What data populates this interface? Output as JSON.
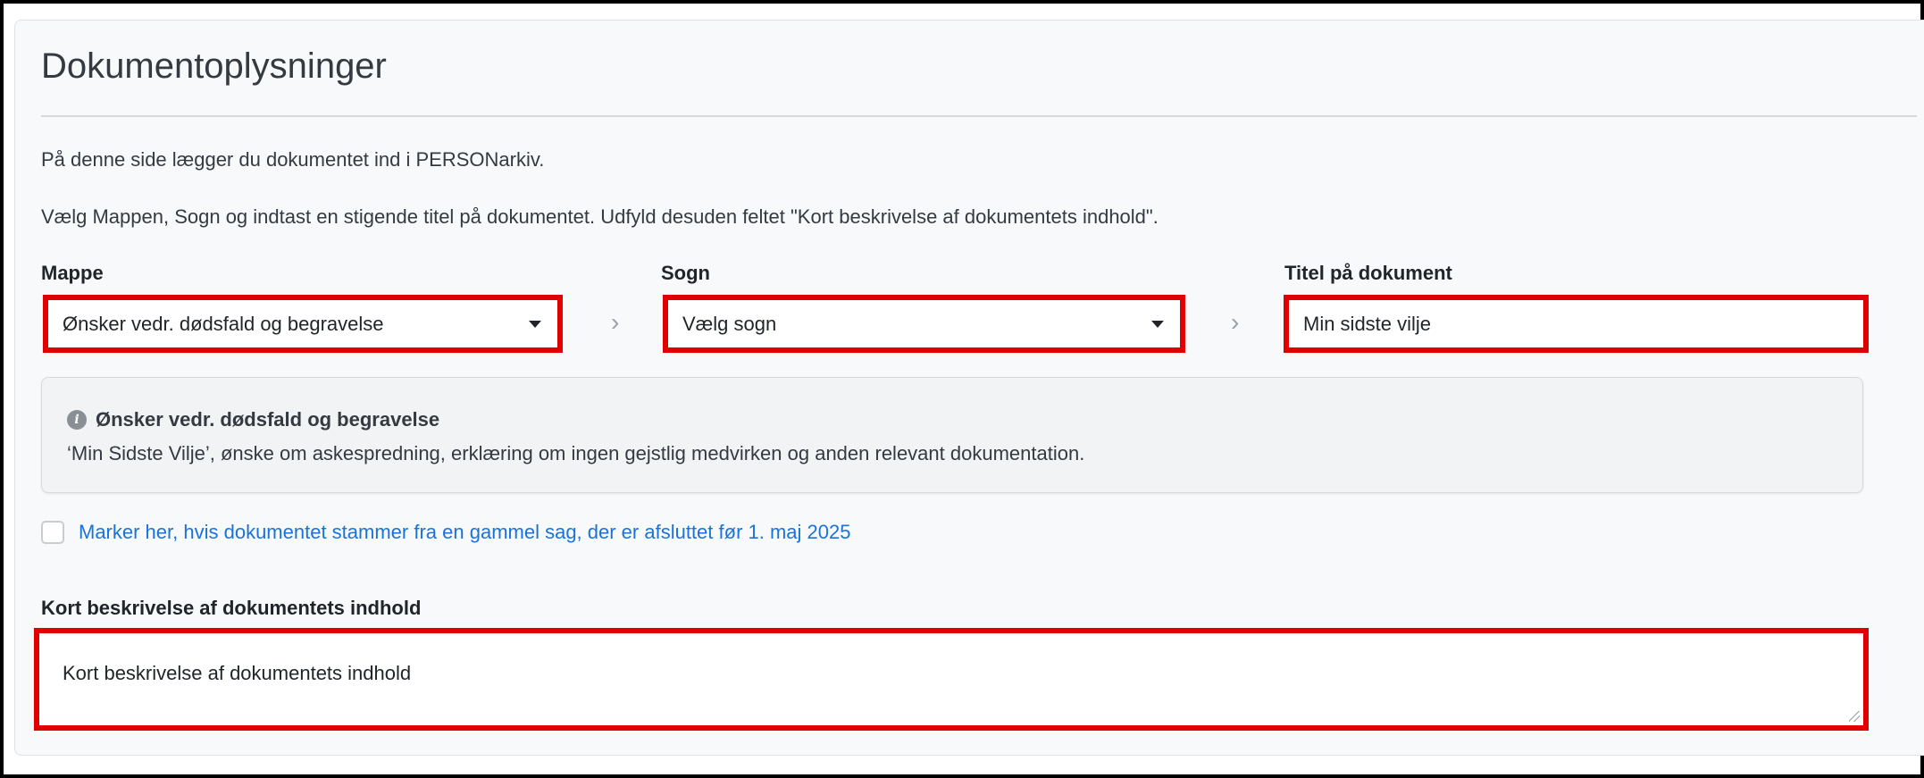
{
  "card": {
    "title": "Dokumentoplysninger",
    "intro_line1": "På denne side lægger du dokumentet ind i PERSONarkiv.",
    "intro_line2": "Vælg Mappen, Sogn og indtast en stigende titel på dokumentet. Udfyld desuden feltet \"Kort beskrivelse af dokumentets indhold\"."
  },
  "fields": {
    "mappe": {
      "label": "Mappe",
      "value": "Ønsker vedr. dødsfald og begravelse"
    },
    "sogn": {
      "label": "Sogn",
      "value": "Vælg sogn"
    },
    "titel": {
      "label": "Titel på dokument",
      "value": "Min sidste vilje"
    }
  },
  "separator_glyph": "›",
  "info_box": {
    "icon": "info-icon",
    "icon_glyph": "i",
    "title": "Ønsker vedr. dødsfald og begravelse",
    "text": "‘Min Sidste Vilje’, ønske om askespredning, erklæring om ingen gejstlig medvirken og anden relevant dokumentation."
  },
  "old_case_checkbox": {
    "label": "Marker her, hvis dokumentet stammer fra en gammel sag, der er afsluttet før 1. maj 2025",
    "checked": false
  },
  "description": {
    "label": "Kort beskrivelse af dokumentets indhold",
    "placeholder": "Kort beskrivelse af dokumentets indhold"
  },
  "colors": {
    "highlight": "#e00000",
    "link": "#1a73d9"
  }
}
